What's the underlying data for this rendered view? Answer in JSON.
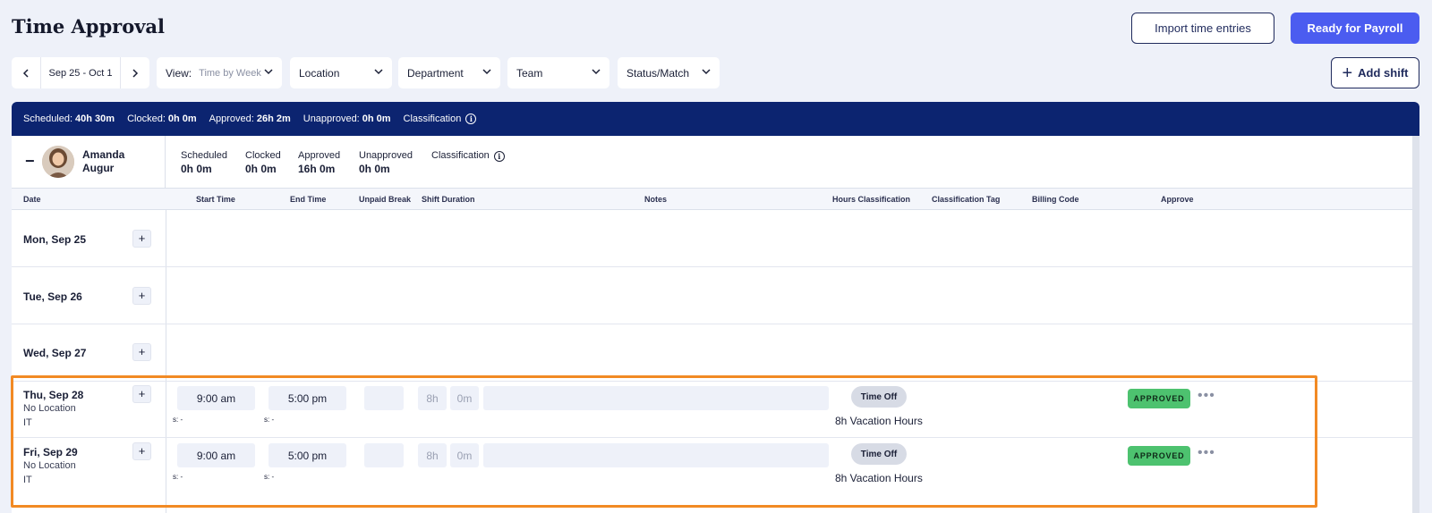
{
  "page": {
    "title": "Time Approval"
  },
  "actions": {
    "import_label": "Import time entries",
    "payroll_label": "Ready for Payroll",
    "add_shift_label": "Add shift"
  },
  "filters": {
    "date_range": "Sep 25 - Oct 1",
    "view_label": "View:",
    "view_value": "Time by Week",
    "location": "Location",
    "department": "Department",
    "team": "Team",
    "status": "Status/Match"
  },
  "summary": {
    "scheduled_label": "Scheduled:",
    "scheduled_value": "40h 30m",
    "clocked_label": "Clocked:",
    "clocked_value": "0h 0m",
    "approved_label": "Approved:",
    "approved_value": "26h 2m",
    "unapproved_label": "Unapproved:",
    "unapproved_value": "0h 0m",
    "classification_label": "Classification"
  },
  "employee": {
    "first_name": "Amanda",
    "last_name": "Augur",
    "stats": [
      {
        "label": "Scheduled",
        "value": "0h 0m"
      },
      {
        "label": "Clocked",
        "value": "0h 0m"
      },
      {
        "label": "Approved",
        "value": "16h 0m"
      },
      {
        "label": "Unapproved",
        "value": "0h 0m"
      }
    ],
    "classification_label": "Classification"
  },
  "columns": [
    "Date",
    "Start Time",
    "End Time",
    "Unpaid Break",
    "Shift Duration",
    "Notes",
    "Hours Classification",
    "Classification Tag",
    "Billing Code",
    "Approve"
  ],
  "days": [
    {
      "date": "Mon, Sep 25"
    },
    {
      "date": "Tue, Sep 26"
    },
    {
      "date": "Wed, Sep 27"
    },
    {
      "date": "Thu, Sep 28",
      "location": "No Location",
      "dept": "IT",
      "start": "9:00 am",
      "end": "5:00 pm",
      "s_start": "s: -",
      "s_end": "s: -",
      "hours": "8h",
      "minutes": "0m",
      "type": "Time Off",
      "classification": "8h Vacation Hours",
      "status": "APPROVED"
    },
    {
      "date": "Fri, Sep 29",
      "location": "No Location",
      "dept": "IT",
      "start": "9:00 am",
      "end": "5:00 pm",
      "s_start": "s: -",
      "s_end": "s: -",
      "hours": "8h",
      "minutes": "0m",
      "type": "Time Off",
      "classification": "8h Vacation Hours",
      "status": "APPROVED"
    }
  ],
  "icons": {
    "prev": "chevron-left-icon",
    "next": "chevron-right-icon",
    "dropdown": "chevron-down-icon",
    "info": "info-icon",
    "more": "more-horizontal-icon",
    "add": "plus-icon",
    "collapse": "minus-icon"
  },
  "colors": {
    "primary": "#4b5cf0",
    "navy": "#0c2470",
    "approved": "#4dc26f",
    "highlight": "#f28a24"
  }
}
